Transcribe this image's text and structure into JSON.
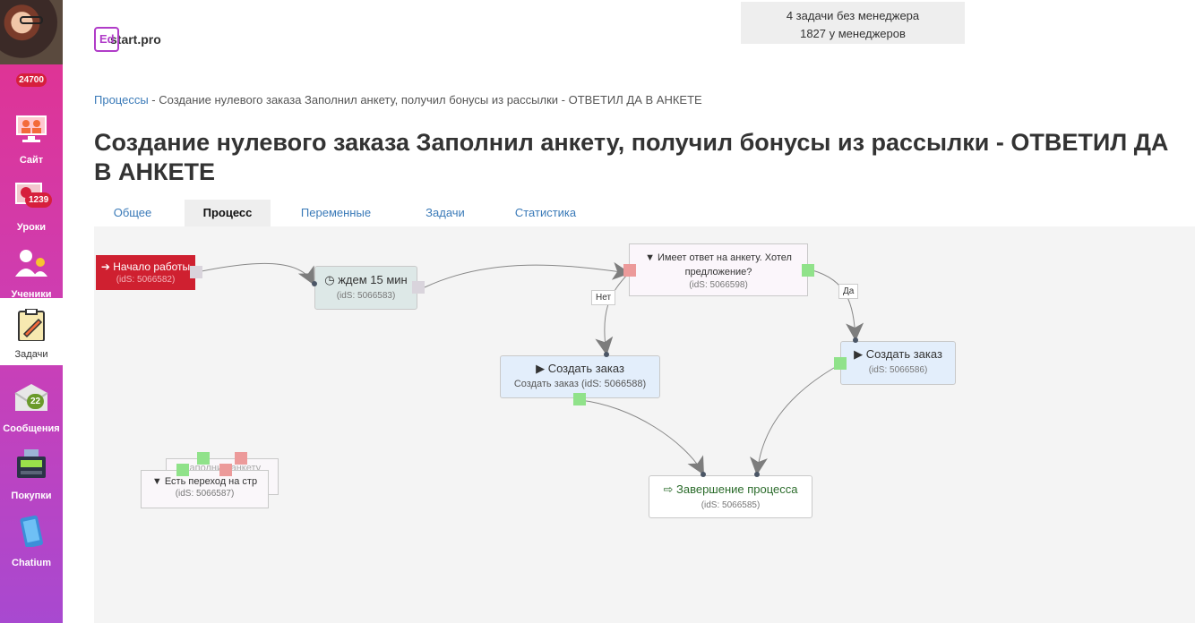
{
  "sidebar": {
    "score": "24700",
    "items": [
      {
        "label": "Сайт",
        "icon": "monitor-users-icon"
      },
      {
        "label": "Уроки",
        "icon": "lessons-icon",
        "badge": "1239"
      },
      {
        "label": "Ученики",
        "icon": "students-icon"
      },
      {
        "label": "Задачи",
        "icon": "clipboard-pencil-icon"
      },
      {
        "label": "Сообщения",
        "icon": "envelope-icon",
        "badge": "22"
      },
      {
        "label": "Покупки",
        "icon": "cash-register-icon"
      },
      {
        "label": "Chatium",
        "icon": "phone-icon"
      }
    ]
  },
  "logo": {
    "mark": "Ed",
    "rest": "start.pro"
  },
  "managers": {
    "line1": "4 задачи без менеджера",
    "line2": "1827 у менеджеров"
  },
  "breadcrumb": {
    "root": "Процессы",
    "sep": " - ",
    "current": "Создание нулевого заказа Заполнил анкету, получил бонусы из рассылки - ОТВЕТИЛ ДА В АНКЕТЕ"
  },
  "title": "Создание нулевого заказа Заполнил анкету, получил бонусы из рассылки - ОТВЕТИЛ ДА В АНКЕТЕ",
  "tabs": [
    {
      "label": "Общее"
    },
    {
      "label": "Процесс"
    },
    {
      "label": "Переменные"
    },
    {
      "label": "Задачи"
    },
    {
      "label": "Статистика"
    }
  ],
  "colors": {
    "sidebar_top": "#e3318e",
    "sidebar_bottom": "#a849d0",
    "start_node": "#cf2030",
    "link": "#3a7ab8"
  },
  "nodes": {
    "start": {
      "title": "Начало работы",
      "sub": "(idS: 5066582)",
      "icon": "sign-in-icon"
    },
    "wait": {
      "title": "ждем 15 мин",
      "sub": "(idS: 5066583)",
      "icon": "clock-icon"
    },
    "check": {
      "title": "Имеет ответ на анкету. Хотел предложение?",
      "sub": "(idS: 5066598)",
      "icon": "filter-icon"
    },
    "order_no": {
      "title": "Создать заказ",
      "sub": "Создать заказ (idS: 5066588)",
      "icon": "play-icon"
    },
    "order_yes": {
      "title": "Создать заказ",
      "sub": "(idS: 5066586)",
      "icon": "play-icon"
    },
    "end": {
      "title": "Завершение процесса",
      "sub": "(idS: 5066585)",
      "icon": "sign-out-icon"
    },
    "transition": {
      "title": "Есть переход на стр",
      "sub": "(idS: 5066587)",
      "icon": "filter-icon",
      "behind": "Заполнил анкету"
    }
  },
  "edge_labels": {
    "no": "Нет",
    "yes": "Да"
  }
}
